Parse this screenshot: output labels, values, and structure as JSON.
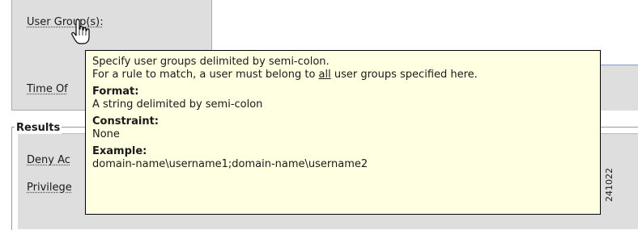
{
  "fields": {
    "user_groups_label": "User Group(s):",
    "time_of_label": "Time Of",
    "results_legend": "Results",
    "deny_access_label": "Deny Ac",
    "privilege_label": "Privilege"
  },
  "tooltip": {
    "line1": "Specify user groups delimited by semi-colon.",
    "line2_before": "For a rule to match, a user must belong to ",
    "line2_emphasis": "all",
    "line2_after": " user groups specified here.",
    "format_heading": "Format:",
    "format_text": "A string delimited by semi-colon",
    "constraint_heading": "Constraint:",
    "constraint_text": "None",
    "example_heading": "Example:",
    "example_text": "domain-name\\username1;domain-name\\username2"
  },
  "figure_id": "241022",
  "icons": {
    "pointer": "hand-pointer-icon"
  },
  "colors": {
    "tooltip_bg": "#ffffe1",
    "panel_bg": "#dedede"
  }
}
